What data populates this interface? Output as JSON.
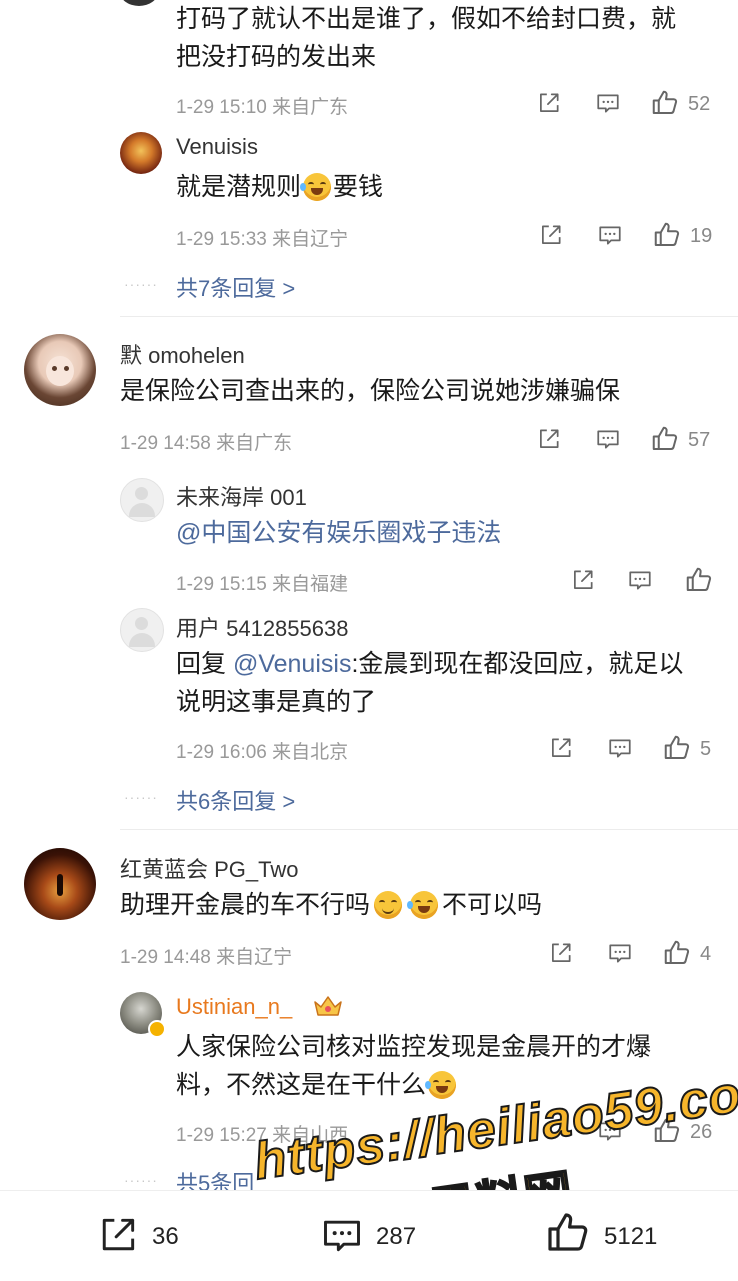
{
  "comments": [
    {
      "text_lines": [
        "打码了就认不出是谁了，假如不给封口费，就",
        "把没打码的发出来"
      ],
      "time": "1-29 15:10",
      "location": "来自广东",
      "likes": "52",
      "replies": [
        {
          "name": "Venuisis",
          "text_before": "就是潜规则",
          "text_after": "要钱",
          "time": "1-29 15:33",
          "location": "来自辽宁",
          "likes": "19"
        }
      ],
      "more": "共7条回复 >"
    },
    {
      "name": "默 omohelen",
      "text": "是保险公司查出来的，保险公司说她涉嫌骗保",
      "time": "1-29 14:58",
      "location": "来自广东",
      "likes": "57",
      "replies": [
        {
          "name": "未来海岸 001",
          "text": "@中国公安有娱乐圈戏子违法",
          "time": "1-29 15:15",
          "location": "来自福建",
          "likes": ""
        },
        {
          "name": "用户 5412855638",
          "prefix": "回复 ",
          "mention": "@Venuisis",
          "text_line1": ":金晨到现在都没回应，就足以",
          "text_line2": "说明这事是真的了",
          "time": "1-29 16:06",
          "location": "来自北京",
          "likes": "5"
        }
      ],
      "more": "共6条回复 >"
    },
    {
      "name": "红黄蓝会 PG_Two",
      "text_before": "助理开金晨的车不行吗",
      "text_after": "不可以吗",
      "time": "1-29 14:48",
      "location": "来自辽宁",
      "likes": "4",
      "replies": [
        {
          "name": "Ustinian_n_",
          "text_line1": "人家保险公司核对监控发现是金晨开的才爆",
          "text_line2": "料，不然这是在干什么",
          "time": "1-29 15:27",
          "location": "来自山西",
          "likes": "26"
        }
      ],
      "more": "共5条回"
    }
  ],
  "bottom_bar": {
    "share_count": "36",
    "comment_count": "287",
    "like_count": "5121"
  },
  "watermark": {
    "line1": "https://heiliao59.com",
    "line2": "黑料网"
  },
  "colors": {
    "link": "#4d6a9c",
    "meta": "#999999",
    "vip_name": "#e8791e",
    "watermark": "#f6b52b"
  }
}
